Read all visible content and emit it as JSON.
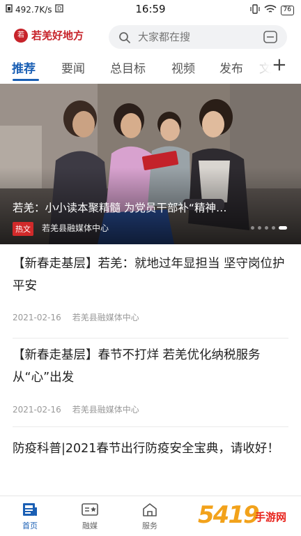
{
  "status_bar": {
    "speed": "492.7K/s",
    "time": "16:59",
    "battery": "76"
  },
  "header": {
    "logo_text": "若羌好地方",
    "logo_badge": "若",
    "search_placeholder": "大家都在搜"
  },
  "tabs": [
    "推荐",
    "要闻",
    "总目标",
    "视频",
    "发布",
    "文"
  ],
  "banner": {
    "title": "若羌：小小读本聚精髓 为党员干部补“精神…",
    "tag": "热文",
    "source": "若羌县融媒体中心"
  },
  "articles": [
    {
      "title": "【新春走基层】若羌：就地过年显担当 坚守岗位护平安",
      "date": "2021-02-16",
      "source": "若羌县融媒体中心"
    },
    {
      "title": "【新春走基层】春节不打烊 若羌优化纳税服务 从“心”出发",
      "date": "2021-02-16",
      "source": "若羌县融媒体中心"
    },
    {
      "title": "防疫科普|2021春节出行防疫安全宝典，请收好！"
    }
  ],
  "bottom_nav": [
    "首页",
    "融媒",
    "服务"
  ],
  "watermark": {
    "number": "5419",
    "text": "手游网"
  },
  "colors": {
    "accent": "#1a5fb4",
    "brand": "#c7232a",
    "hot_tag": "#d12a2a"
  }
}
